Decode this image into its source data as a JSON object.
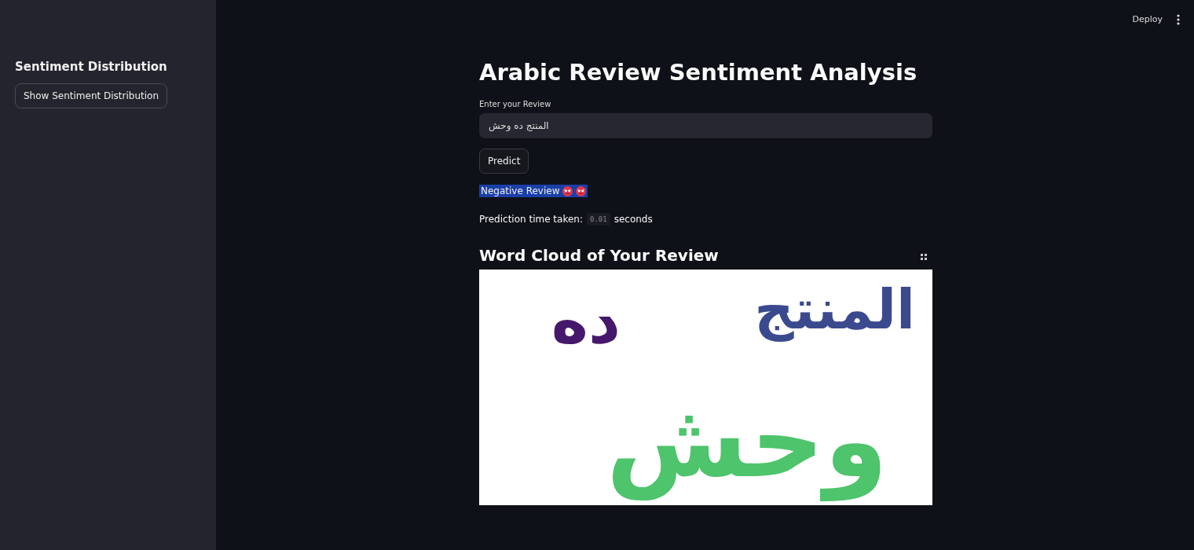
{
  "toolbar": {
    "deploy": "Deploy"
  },
  "sidebar": {
    "heading": "Sentiment Distribution",
    "button": "Show Sentiment Distribution"
  },
  "main": {
    "title": "Arabic Review Sentiment Analysis",
    "review_field": {
      "label": "Enter your Review",
      "value": "المنتج ده وحش"
    },
    "predict_button": "Predict",
    "result": {
      "text": "Negative Review",
      "highlighted": true,
      "emojis": [
        {
          "kind": "angry"
        },
        {
          "kind": "angry"
        }
      ]
    },
    "timing": {
      "prefix": "Prediction time taken:",
      "value": "0.01",
      "suffix": "seconds"
    },
    "word_cloud": {
      "heading": "Word Cloud of Your Review",
      "words": [
        {
          "text": "المنتج",
          "color": "#3b4a8e"
        },
        {
          "text": "ده",
          "color": "#45186b"
        },
        {
          "text": "وحش",
          "color": "#4ec46c"
        }
      ]
    }
  }
}
